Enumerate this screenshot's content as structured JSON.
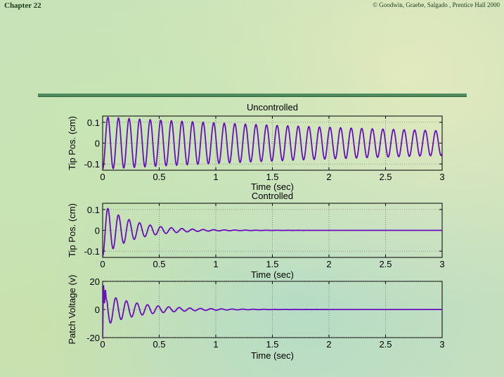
{
  "header": {
    "chapter": "Chapter 22",
    "copyright": "© Goodwin, Graebe, Salgado , Prentice Hall 2000"
  },
  "colors": {
    "signal": "#6a0dbe",
    "axis": "#000000",
    "grid": "#555555"
  },
  "chart_data": [
    {
      "type": "line",
      "title": "Uncontrolled",
      "xlabel": "Time (sec)",
      "ylabel": "Tip Pos. (cm)",
      "xlim": [
        0,
        3
      ],
      "ylim": [
        -0.13,
        0.13
      ],
      "xticks": [
        0,
        0.5,
        1,
        1.5,
        2,
        2.5,
        3
      ],
      "xtick_labels": [
        "0",
        "0.5",
        "1",
        "1.5",
        "2",
        "2.5",
        "3"
      ],
      "yticks": [
        -0.1,
        0,
        0.1
      ],
      "ytick_labels": [
        "-0.1",
        "0",
        "0.1"
      ],
      "grid": true,
      "series": [
        {
          "frequency_hz": 10.7,
          "amplitude": 0.125,
          "decay_per_sec": 0.25,
          "phase": -1.5708,
          "initial_transient": false
        }
      ]
    },
    {
      "type": "line",
      "title": "Controlled",
      "xlabel": "Time (sec)",
      "ylabel": "Tip Pos. (cm)",
      "xlim": [
        0,
        3
      ],
      "ylim": [
        -0.13,
        0.13
      ],
      "xticks": [
        0,
        0.5,
        1,
        1.5,
        2,
        2.5,
        3
      ],
      "xtick_labels": [
        "0",
        "0.5",
        "1",
        "1.5",
        "2",
        "2.5",
        "3"
      ],
      "yticks": [
        -0.1,
        0,
        0.1
      ],
      "ytick_labels": [
        "-0.1",
        "0",
        "0.1"
      ],
      "grid": true,
      "series": [
        {
          "frequency_hz": 10.7,
          "amplitude": 0.125,
          "decay_per_sec": 3.8,
          "phase": -1.5708,
          "initial_transient": false
        }
      ]
    },
    {
      "type": "line",
      "title": "",
      "xlabel": "Time (sec)",
      "ylabel": "Patch Voltage (v)",
      "xlim": [
        0,
        3
      ],
      "ylim": [
        -20,
        20
      ],
      "xticks": [
        0,
        0.5,
        1,
        1.5,
        2,
        2.5,
        3
      ],
      "xtick_labels": [
        "0",
        "0.5",
        "1",
        "1.5",
        "2",
        "2.5",
        "3"
      ],
      "yticks": [
        -20,
        0,
        20
      ],
      "ytick_labels": [
        "-20",
        "0",
        "20"
      ],
      "grid": true,
      "series": [
        {
          "frequency_hz": 10.7,
          "amplitude": 12,
          "decay_per_sec": 3.2,
          "phase": 0,
          "initial_transient": true
        }
      ]
    }
  ]
}
